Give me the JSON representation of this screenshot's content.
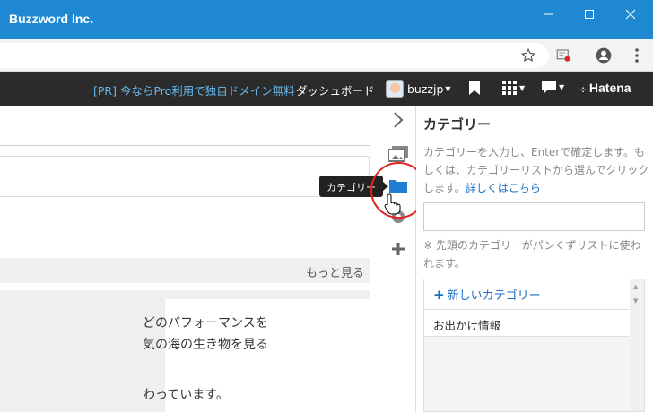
{
  "window": {
    "title": "Buzzword Inc.",
    "controls": {
      "minimize": "—",
      "maximize": "☐",
      "close": "✕"
    }
  },
  "addressbar": {
    "icons": [
      "star-icon",
      "cast-icon",
      "account-icon",
      "menu-icon"
    ]
  },
  "hatena_nav": {
    "promo": "[PR] 今ならPro利用で独自ドメイン無料",
    "dashboard": "ダッシュボード",
    "username": "buzzjp",
    "logo": "Hatena",
    "promo_color": "#67b8ee"
  },
  "editor": {
    "more_link": "もっと見る",
    "preview_lines": [
      "どのパフォーマンスを",
      "気の海の生き物を見る",
      "",
      "わっています。"
    ]
  },
  "tooltip": {
    "text": "カテゴリー"
  },
  "category_panel": {
    "title": "カテゴリー",
    "description": "カテゴリーを入力し、Enterで確定します。もしくは、カテゴリーリストから選んでクリックします。",
    "details_link": "詳しくはこちら",
    "input_value": "",
    "note": "※ 先頭のカテゴリーがパンくずリストに使われます。",
    "new_category": "新しいカテゴリー",
    "categories": [
      "お出かけ情報"
    ]
  },
  "colors": {
    "titlebar": "#1e88d2",
    "accent": "#1a73c8",
    "highlight_ring": "#e0231c"
  }
}
